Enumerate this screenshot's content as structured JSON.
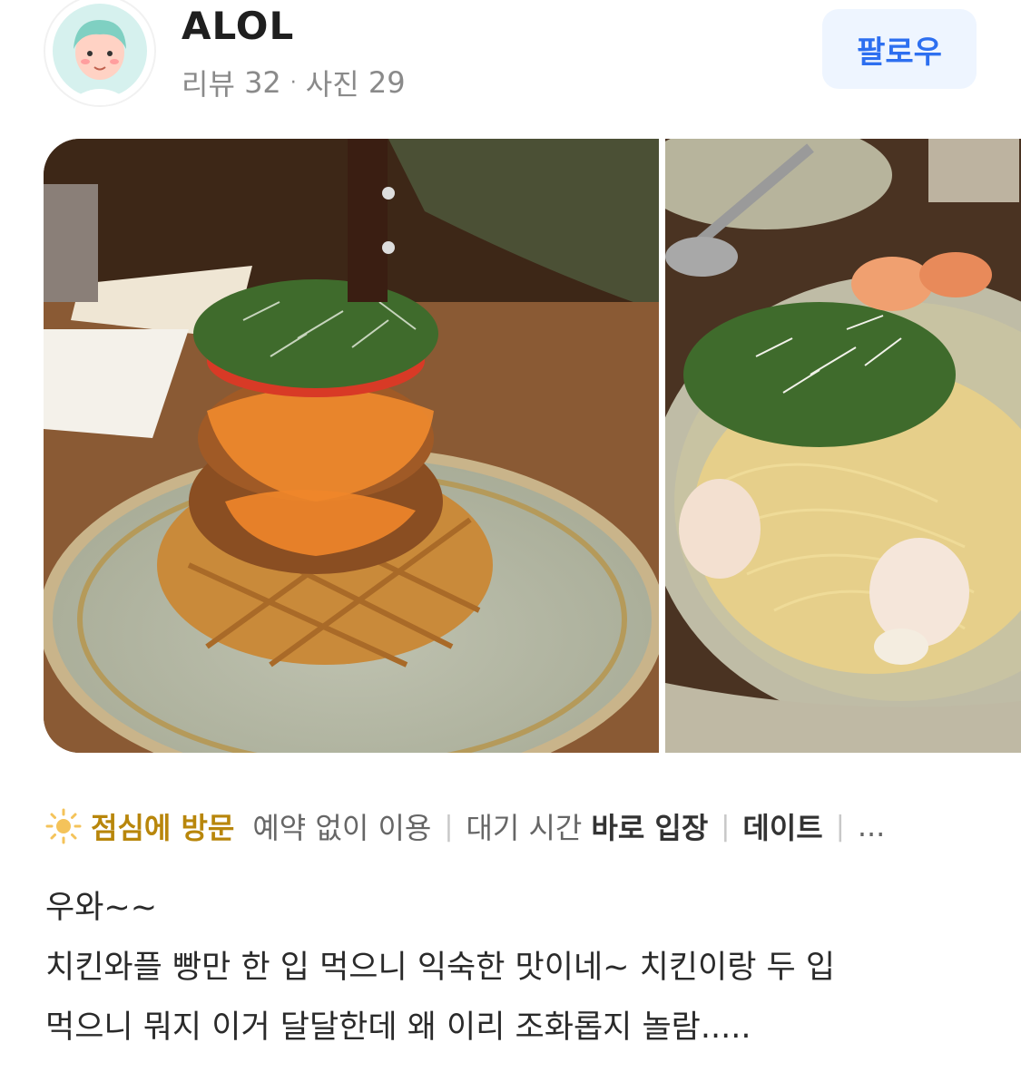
{
  "user": {
    "name": "ALOL",
    "review_label": "리뷰",
    "review_count": "32",
    "photo_label": "사진",
    "photo_count": "29"
  },
  "follow_label": "팔로우",
  "photos": [
    {
      "name": "chicken-waffle-photo"
    },
    {
      "name": "shrimp-pasta-photo"
    }
  ],
  "visit": {
    "icon": "sun-icon",
    "time": "점심에 방문",
    "tags": [
      {
        "key": "",
        "value": "예약 없이 이용"
      },
      {
        "key": "대기 시간",
        "value": "바로 입장"
      },
      {
        "key": "",
        "value": "데이트"
      }
    ],
    "more": "..."
  },
  "review": {
    "lines": [
      "우와~~",
      "치킨와플 빵만 한 입 먹으니 익숙한 맛이네~ 치킨이랑 두 입",
      "먹으니 뭐지 이거 달달한데 왜 이리 조화롭지 놀람....."
    ]
  },
  "colors": {
    "accent": "#2d6ff0",
    "follow_bg": "#eef5ff",
    "visit_highlight": "#b8860b"
  }
}
